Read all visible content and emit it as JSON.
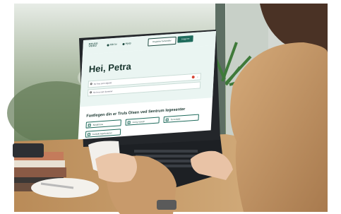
{
  "header": {
    "logo_text": "MELBO\nVIDEO",
    "nav_1": "Mitt liv",
    "nav_2": "Hjelp",
    "button_outline": "Registrer behandler",
    "button_primary": "Logg inn"
  },
  "greeting": "Hei, Petra",
  "rows": [
    {
      "label": "Se hva som skjedd"
    },
    {
      "label": "Se hva som kommer"
    }
  ],
  "section_title": "Fastlegen din er Truls Olsen ved Sentrum legesenter",
  "tiles": [
    {
      "label": "Bestill time"
    },
    {
      "label": "Forny resept"
    },
    {
      "label": "Ta kontakt"
    },
    {
      "label": "Kontakt legekontoret"
    }
  ],
  "colors": {
    "wall": "#cfd6d1",
    "window_green": "#7d9270",
    "table_wood": "#cfa46f",
    "sweater": "#c79a6a",
    "hair": "#4a3225",
    "laptop": "#23262a",
    "screen_header": "#eaf5f2",
    "accent": "#1f6b5c",
    "notification": "#d64533"
  }
}
